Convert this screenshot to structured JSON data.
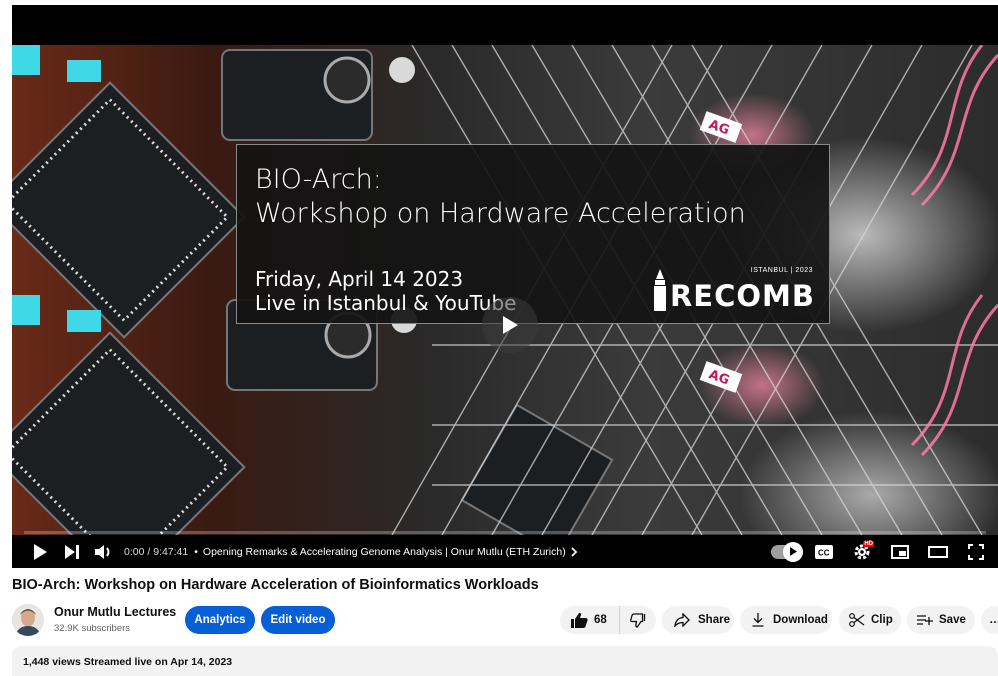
{
  "player": {
    "title_card": {
      "title_line1": "BIO-Arch:",
      "title_line2": "Workshop on Hardware Acceleration",
      "date_line": "Friday, April 14 2023",
      "location_line": "Live in Istanbul & YouTube",
      "logo_word": "RECOMB",
      "logo_city": "ISTANBUL | 2023"
    },
    "progress_fraction": 0.0,
    "colors": {
      "progress": "#ff0000",
      "controls_bg": "#000000"
    },
    "controls": {
      "time": "0:00 / 9:47:41",
      "chapter_separator": "•",
      "chapter": "Opening Remarks & Accelerating Genome Analysis | Onur Mutlu (ETH Zurich)",
      "hd_badge": "HD",
      "icons": [
        "play-icon",
        "next-icon",
        "volume-icon",
        "chevron-right-icon",
        "autoplay-toggle",
        "captions-icon",
        "settings-icon",
        "miniplayer-icon",
        "theater-icon",
        "fullscreen-icon"
      ]
    }
  },
  "video": {
    "title": "BIO-Arch: Workshop on Hardware Acceleration of Bioinformatics Workloads"
  },
  "channel": {
    "name": "Onur Mutlu Lectures",
    "subscribers": "32.9K subscribers",
    "analytics_label": "Analytics",
    "edit_label": "Edit video"
  },
  "actions": {
    "likes": "68",
    "share_label": "Share",
    "download_label": "Download",
    "clip_label": "Clip",
    "save_label": "Save",
    "more_label": "…",
    "colors": {
      "primary_button": "#065fd4",
      "pill": "#f2f2f2"
    }
  },
  "description": {
    "stats": "1,448 views  Streamed live on Apr 14, 2023"
  }
}
